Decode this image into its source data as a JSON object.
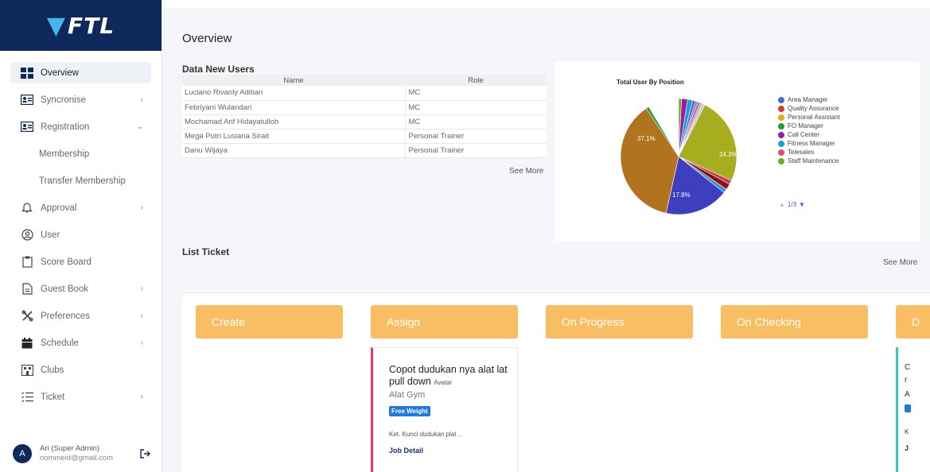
{
  "brand": {
    "logo_text": "FTL"
  },
  "sidebar": {
    "items": [
      {
        "label": "Overview",
        "icon": "grid-icon"
      },
      {
        "label": "Syncronise",
        "icon": "id-card-icon"
      },
      {
        "label": "Registration",
        "icon": "id-card-icon"
      },
      {
        "label": "Membership"
      },
      {
        "label": "Transfer Membership"
      },
      {
        "label": "Approval",
        "icon": "bell-icon"
      },
      {
        "label": "User",
        "icon": "user-circle-icon"
      },
      {
        "label": "Score Board",
        "icon": "clipboard-icon"
      },
      {
        "label": "Guest Book",
        "icon": "document-icon"
      },
      {
        "label": "Preferences",
        "icon": "tools-icon"
      },
      {
        "label": "Schedule",
        "icon": "calendar-icon"
      },
      {
        "label": "Clubs",
        "icon": "building-icon"
      },
      {
        "label": "Ticket",
        "icon": "list-icon"
      }
    ],
    "user": {
      "initial": "A",
      "name": "Ari (Super Admin)",
      "email": "nommeid@gmail.com"
    }
  },
  "header": {
    "title": "Overview"
  },
  "users_section": {
    "title": "Data New Users",
    "columns": [
      "Name",
      "Role"
    ],
    "rows": [
      [
        "Luciano Rivanly Aditian",
        "MC"
      ],
      [
        "Febriyani Wulandari",
        "MC"
      ],
      [
        "Mochamad Arif Hidayatulloh",
        "MC"
      ],
      [
        "Mega Putri Lusiana Sirait",
        "Personal Trainer"
      ],
      [
        "Danu Wijaya",
        "Personal Trainer"
      ]
    ],
    "see_more": "See More"
  },
  "chart_data": {
    "type": "pie",
    "title": "Total User By Position",
    "slice_labels": [
      "37.1%",
      "24.3%",
      "17.8%"
    ],
    "legend": [
      {
        "name": "Area Manager",
        "color": "#3b6fd6"
      },
      {
        "name": "Quality Assurance",
        "color": "#d23b2e"
      },
      {
        "name": "Personal Assistant",
        "color": "#f5a31a"
      },
      {
        "name": "FO Manager",
        "color": "#1f9e3b"
      },
      {
        "name": "Call Center",
        "color": "#9b1aa8"
      },
      {
        "name": "Fitness Manager",
        "color": "#1c9ed6"
      },
      {
        "name": "Telesales",
        "color": "#e2487a"
      },
      {
        "name": "Staff Maintenance",
        "color": "#6cad2a"
      }
    ],
    "legend_pager": "1/3"
  },
  "tickets_section": {
    "title": "List Ticket",
    "see_more": "See More",
    "columns": [
      "Create",
      "Assign",
      "On Progress",
      "On Checking",
      "D"
    ],
    "card": {
      "title": "Copot dudukan nya alat lat pull down",
      "avatar_text": "Avatar",
      "subtitle": "Alat Gym",
      "tag": "Free Weight",
      "note": "Ket. Kunci dudukan plat ..",
      "link": "Job Detail"
    },
    "partial_card": {
      "lines": [
        "C",
        "r",
        "A",
        "K",
        "J"
      ]
    }
  }
}
